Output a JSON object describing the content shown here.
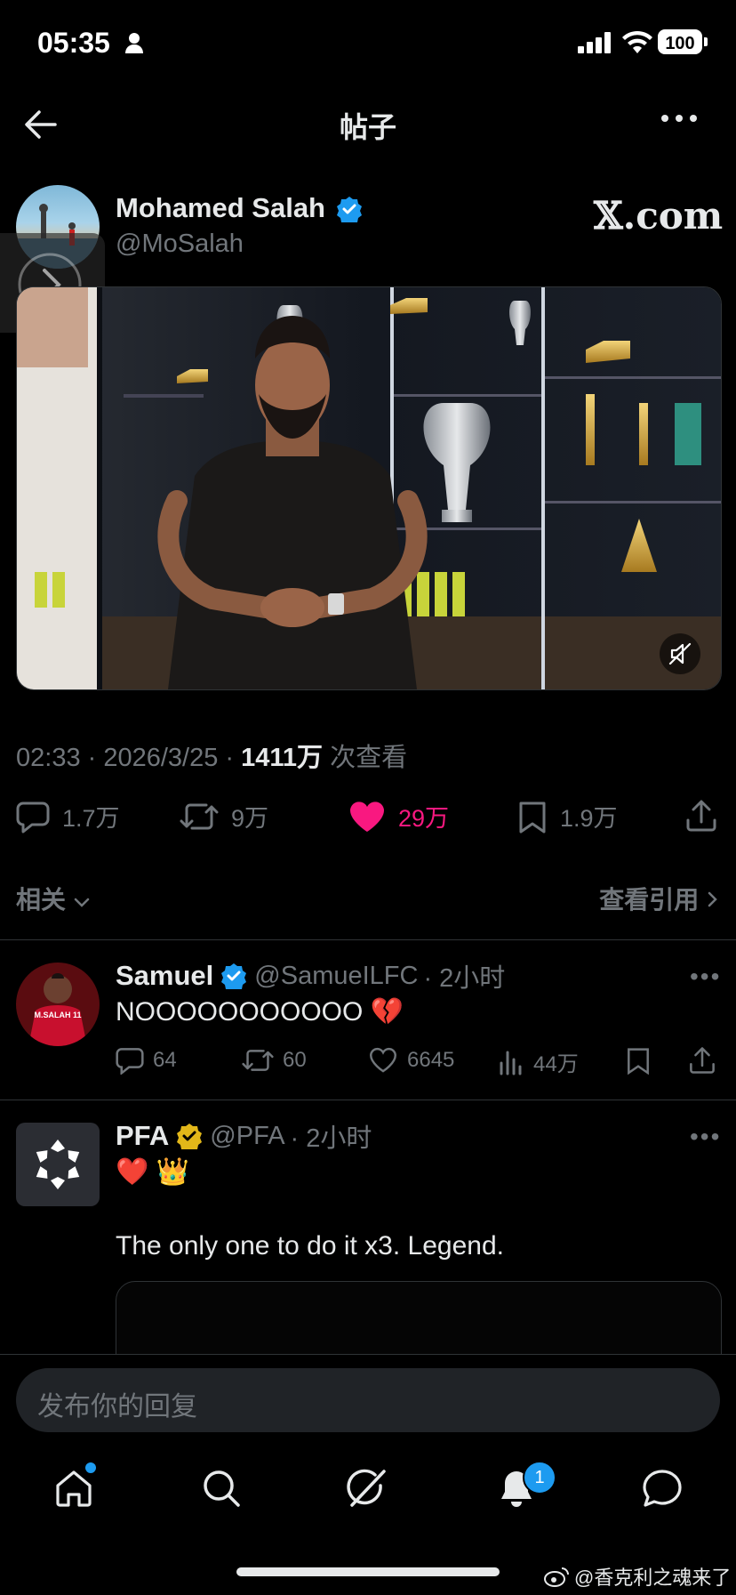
{
  "status_bar": {
    "time": "05:35",
    "battery": "100"
  },
  "header": {
    "title": "帖子"
  },
  "post": {
    "author_name": "Mohamed Salah",
    "author_handle": "@MoSalah",
    "source_logo_text": "𝕏.com",
    "meta_time": "02:33 · 2026/3/25 · ",
    "meta_views": "1411万",
    "meta_views_suffix": " 次查看",
    "replies": "1.7万",
    "reposts": "9万",
    "likes": "29万",
    "bookmarks": "1.9万"
  },
  "related": {
    "label": "相关",
    "quotes_label": "查看引用"
  },
  "replies": [
    {
      "name": "Samuel",
      "handle": "@SamueILFC",
      "time": "· 2小时",
      "text": "NOOOOOOOOOOO 💔",
      "avatar_text": "M.SALAH 11",
      "comments": "64",
      "reposts": "60",
      "likes": "6645",
      "views": "44万"
    },
    {
      "name": "PFA",
      "handle": "@PFA",
      "time": "· 2小时",
      "emoji": "❤️ 👑",
      "text": "The only one to do it x3. Legend."
    }
  ],
  "composer": {
    "placeholder": "发布你的回复"
  },
  "nav": {
    "notif_count": "1",
    "items": [
      "home-icon",
      "search-icon",
      "grok-icon",
      "bell-icon",
      "messages-icon"
    ]
  },
  "watermark": {
    "text": "@香克利之魂来了"
  },
  "colors": {
    "accent": "#1d9bf0",
    "like": "#f91880",
    "muted": "#71767b",
    "gold": "#f4c542"
  }
}
